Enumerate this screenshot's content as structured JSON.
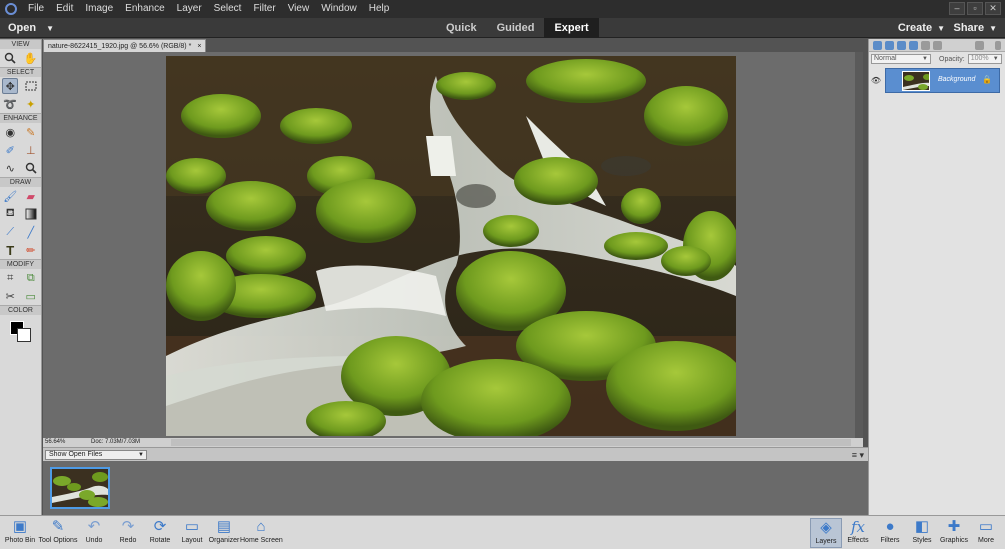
{
  "menu": {
    "items": [
      "File",
      "Edit",
      "Image",
      "Enhance",
      "Layer",
      "Select",
      "Filter",
      "View",
      "Window",
      "Help"
    ],
    "window_controls": [
      "–",
      "▫",
      "✕"
    ]
  },
  "modebar": {
    "open_label": "Open",
    "modes": [
      "Quick",
      "Guided",
      "Expert"
    ],
    "active_mode": "Expert",
    "create_label": "Create",
    "share_label": "Share"
  },
  "toolbar": {
    "sections": {
      "view": "VIEW",
      "select": "SELECT",
      "enhance": "ENHANCE",
      "draw": "DRAW",
      "modify": "MODIFY",
      "color": "COLOR"
    },
    "tools": {
      "zoom": "zoom-icon",
      "hand": "hand-icon",
      "move": "move-icon",
      "marquee": "marquee-icon",
      "lasso": "lasso-icon",
      "magic_wand": "magic-wand-icon",
      "red_eye": "red-eye-icon",
      "spot_healing": "spot-healing-icon",
      "smart_brush": "smart-brush-icon",
      "clone_stamp": "clone-stamp-icon",
      "blur": "blur-icon",
      "sponge": "sponge-icon",
      "brush": "brush-icon",
      "eraser": "eraser-icon",
      "paint_bucket": "paint-bucket-icon",
      "gradient": "gradient-icon",
      "eyedropper": "eyedropper-icon",
      "line": "line-icon",
      "type": "type-icon",
      "pencil": "pencil-icon",
      "crop": "crop-icon",
      "recompose": "recompose-icon",
      "content_move": "content-move-icon",
      "straighten": "straighten-icon"
    },
    "foreground_color": "#000000",
    "background_color": "#ffffff"
  },
  "document": {
    "tab_title": "nature-8622415_1920.jpg @ 56.6% (RGB/8) *",
    "close": "×"
  },
  "status": {
    "zoom": "56.64%",
    "doc_size": "Doc: 7.03M/7.03M"
  },
  "photo_bin": {
    "show_label": "Show Open Files"
  },
  "layers_panel": {
    "blend_mode": "Normal",
    "opacity_label": "Opacity:",
    "opacity_value": "100%",
    "layers": [
      {
        "name": "Background",
        "visible": true,
        "locked": true
      }
    ]
  },
  "taskbar": {
    "left": [
      {
        "label": "Photo Bin",
        "icon": "photo-bin-icon"
      },
      {
        "label": "Tool Options",
        "icon": "tool-options-icon"
      },
      {
        "label": "Undo",
        "icon": "undo-icon"
      },
      {
        "label": "Redo",
        "icon": "redo-icon"
      },
      {
        "label": "Rotate",
        "icon": "rotate-icon"
      },
      {
        "label": "Layout",
        "icon": "layout-icon"
      },
      {
        "label": "Organizer",
        "icon": "organizer-icon"
      },
      {
        "label": "Home Screen",
        "icon": "home-icon"
      }
    ],
    "right": [
      {
        "label": "Layers",
        "icon": "layers-icon"
      },
      {
        "label": "Effects",
        "icon": "effects-icon"
      },
      {
        "label": "Filters",
        "icon": "filters-icon"
      },
      {
        "label": "Styles",
        "icon": "styles-icon"
      },
      {
        "label": "Graphics",
        "icon": "graphics-icon"
      },
      {
        "label": "More",
        "icon": "more-icon"
      }
    ]
  },
  "colors": {
    "accent": "#5a8ed0",
    "moss": "#7aa82a",
    "water": "#d8dcd6"
  }
}
